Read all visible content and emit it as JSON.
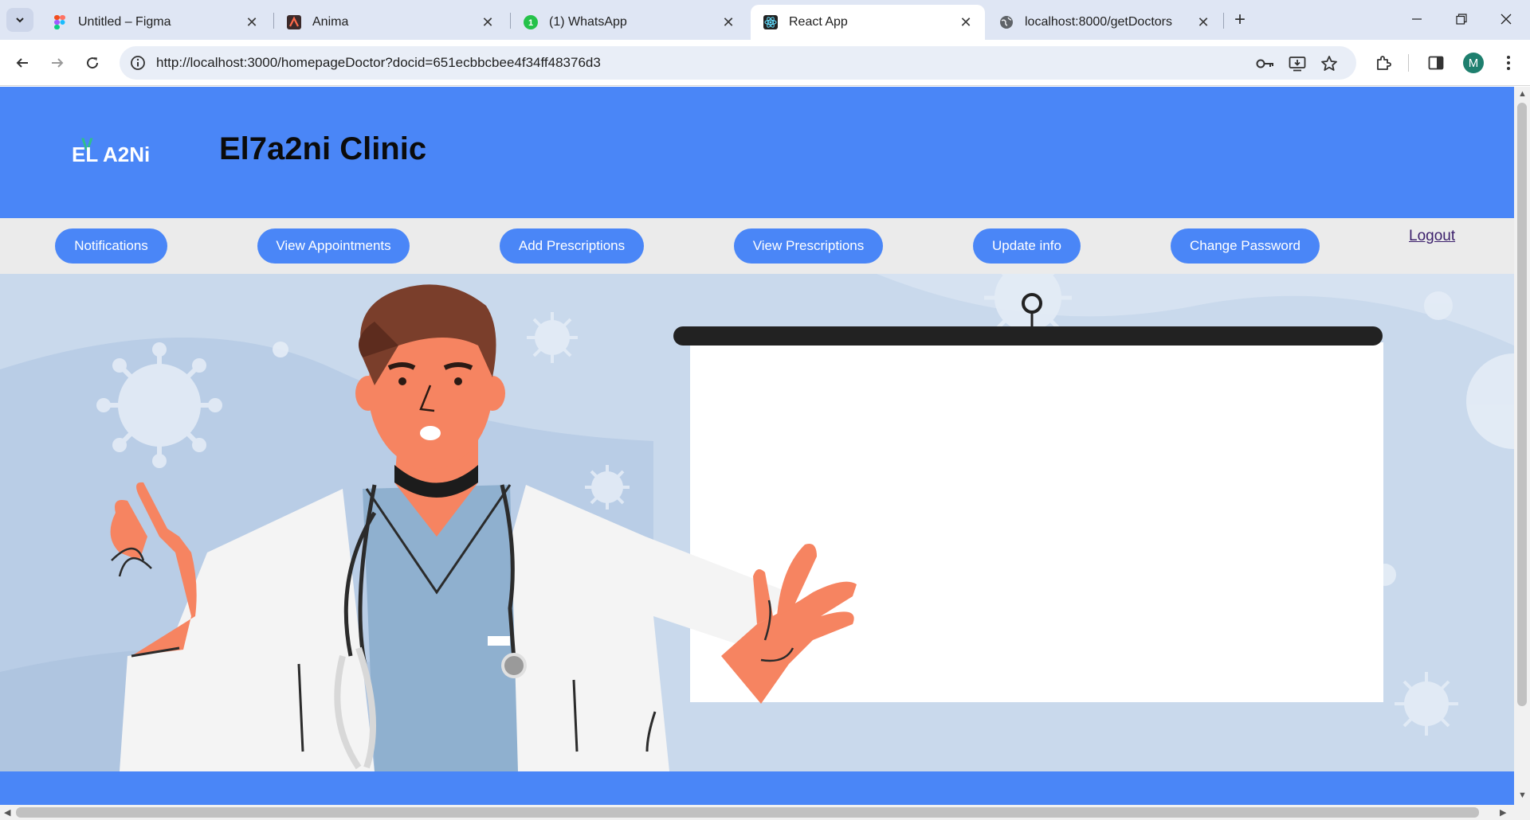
{
  "browser": {
    "tabs": [
      {
        "title": "Untitled – Figma",
        "favicon": "figma-icon",
        "active": false
      },
      {
        "title": "Anima",
        "favicon": "anima-icon",
        "active": false
      },
      {
        "title": "(1) WhatsApp",
        "favicon": "whatsapp-icon",
        "badge": "1",
        "active": false
      },
      {
        "title": "React App",
        "favicon": "react-icon",
        "active": true
      },
      {
        "title": "localhost:8000/getDoctors",
        "favicon": "globe-icon",
        "active": false
      }
    ],
    "url": "http://localhost:3000/homepageDoctor?docid=651ecbbcbee4f34ff48376d3",
    "profile_initial": "M",
    "profile_color": "#1e7f6e"
  },
  "page": {
    "logo_text": "EL A2Ni",
    "logo_accent": "V",
    "title": "El7a2ni Clinic",
    "nav": {
      "notifications": "Notifications",
      "view_appointments": "View Appointments",
      "add_prescriptions": "Add Prescriptions",
      "view_prescriptions": "View Prescriptions",
      "update_info": "Update info",
      "change_password": "Change Password",
      "logout": "Logout"
    },
    "colors": {
      "header": "#4a86f7",
      "navbar": "#ebebeb",
      "pill": "#4a86f7",
      "hero_bg": "#c9d9ec"
    }
  }
}
